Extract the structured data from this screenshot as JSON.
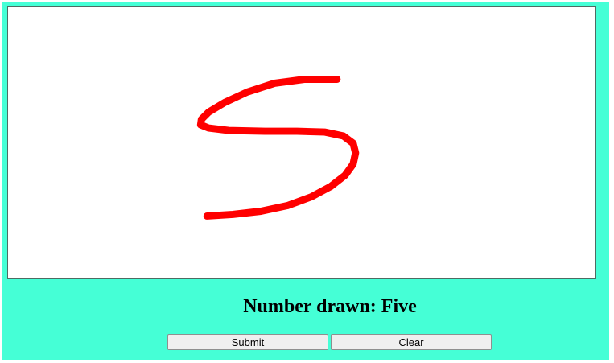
{
  "result": {
    "label": "Number drawn: Five"
  },
  "buttons": {
    "submit_label": "Submit",
    "clear_label": "Clear"
  },
  "colors": {
    "background": "#45ffd6",
    "canvas": "#ffffff",
    "stroke": "#ff0000",
    "button": "#efefef"
  }
}
